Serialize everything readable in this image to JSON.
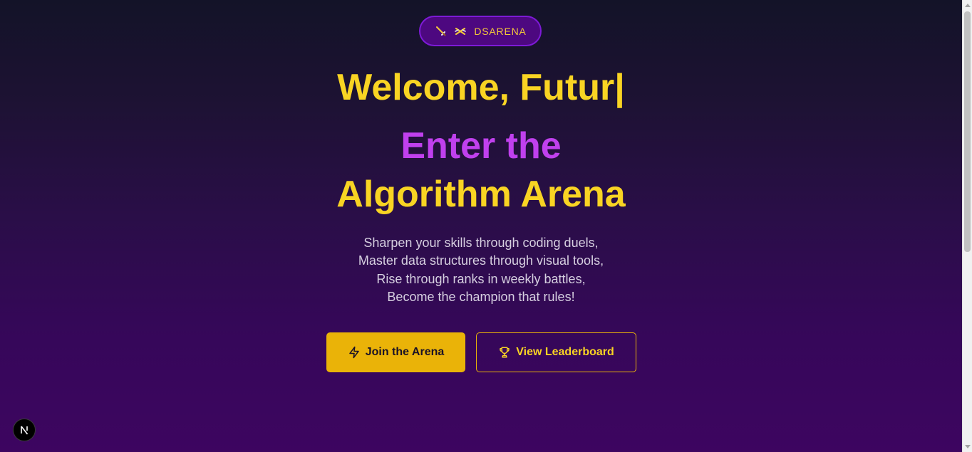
{
  "badge": {
    "text": "DSARENA",
    "icons": [
      "sword-icon",
      "crossed-swords-icon"
    ]
  },
  "hero": {
    "typing_text": "Welcome, Futur",
    "cursor": "|",
    "line1": "Enter the",
    "line2": "Algorithm Arena"
  },
  "tagline": [
    "Sharpen your skills through coding duels,",
    "Master data structures through visual tools,",
    "Rise through ranks in weekly battles,",
    "Become the champion that rules!"
  ],
  "buttons": {
    "join": {
      "label": "Join the Arena",
      "icon": "lightning-icon"
    },
    "leaderboard": {
      "label": "View Leaderboard",
      "icon": "trophy-icon"
    }
  },
  "nextjs_badge": {
    "letter": "N"
  },
  "colors": {
    "accent_yellow": "#f9d423",
    "accent_purple": "#c040ee",
    "button_yellow": "#eab308",
    "badge_bg": "#4d0880"
  }
}
